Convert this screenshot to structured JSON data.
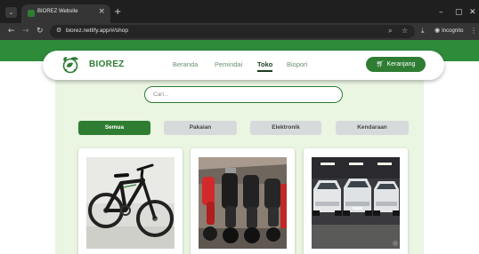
{
  "browser": {
    "tab_title": "BIOREZ Website",
    "url": "biorez.netlify.app/#/shop",
    "incognito_label": "Incognito",
    "colors": {
      "chrome_dark": "#1f1f1f",
      "toolbar": "#353535"
    },
    "icons": [
      "tab-menu-icon",
      "favicon-icon",
      "close-icon",
      "plus-icon",
      "back-icon",
      "forward-icon",
      "reload-icon",
      "site-info-icon",
      "zoom-icon",
      "star-icon",
      "download-icon",
      "incognito-icon",
      "more-icon",
      "minimize-icon",
      "maximize-icon",
      "window-close-icon"
    ]
  },
  "navbar": {
    "brand": "BIOREZ",
    "links": [
      {
        "label": "Beranda",
        "active": false
      },
      {
        "label": "Pemindai",
        "active": false
      },
      {
        "label": "Toko",
        "active": true
      },
      {
        "label": "Biopori",
        "active": false
      }
    ],
    "cart_label": "Keranjang"
  },
  "search": {
    "placeholder": "Cari..."
  },
  "filters": [
    {
      "label": "Semua",
      "active": true
    },
    {
      "label": "Pakaian",
      "active": false
    },
    {
      "label": "Elektronik",
      "active": false
    },
    {
      "label": "Kendaraan",
      "active": false
    }
  ],
  "products": [
    {
      "image": "bicycle-photo"
    },
    {
      "image": "motorcycles-photo"
    },
    {
      "image": "cars-photo"
    }
  ],
  "colors": {
    "brand_green": "#2e7d32",
    "header_band": "#2e8b3a",
    "panel_background": "#eaf5e2",
    "inactive_filter": "#d7dadb"
  }
}
